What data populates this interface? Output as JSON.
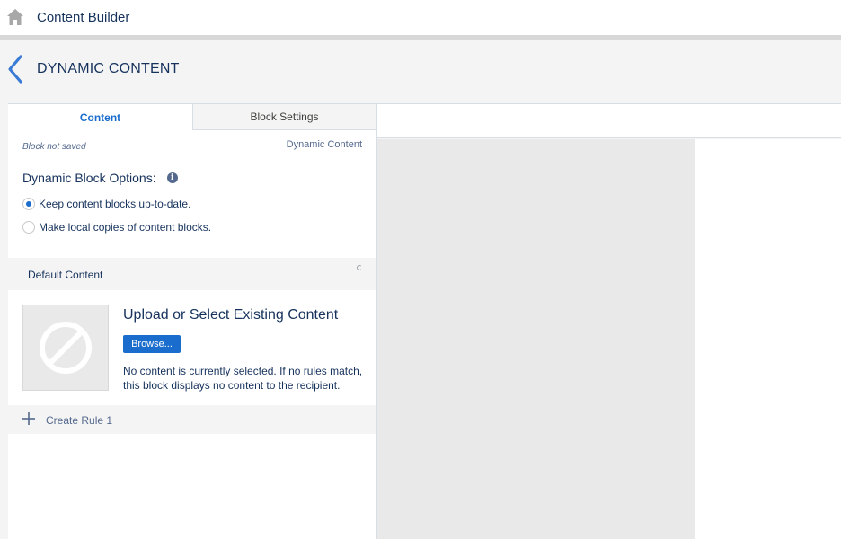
{
  "topbar": {
    "title": "Content Builder",
    "icon": "home-icon"
  },
  "header": {
    "title": "DYNAMIC CONTENT",
    "icon": "chevron-left-icon"
  },
  "tabs": [
    {
      "label": "Content",
      "active": true
    },
    {
      "label": "Block Settings",
      "active": false
    }
  ],
  "status": {
    "left": "Block not saved",
    "right": "Dynamic Content"
  },
  "options": {
    "title": "Dynamic Block Options:",
    "info_icon": "info-icon",
    "radios": [
      {
        "label": "Keep content blocks up-to-date.",
        "checked": true
      },
      {
        "label": "Make local copies of content blocks.",
        "checked": false
      }
    ]
  },
  "default_section": {
    "label": "Default Content"
  },
  "upload": {
    "title": "Upload or Select Existing Content",
    "browse_label": "Browse...",
    "note": "No content is currently selected. If no rules match, this block displays no content to the recipient.",
    "thumb_icon": "no-content-icon"
  },
  "create_rule": {
    "label": "Create Rule 1",
    "icon": "plus-icon"
  },
  "colors": {
    "accent": "#1a6dcc",
    "text": "#16325c",
    "muted": "#54698d",
    "background": "#f4f4f4"
  }
}
